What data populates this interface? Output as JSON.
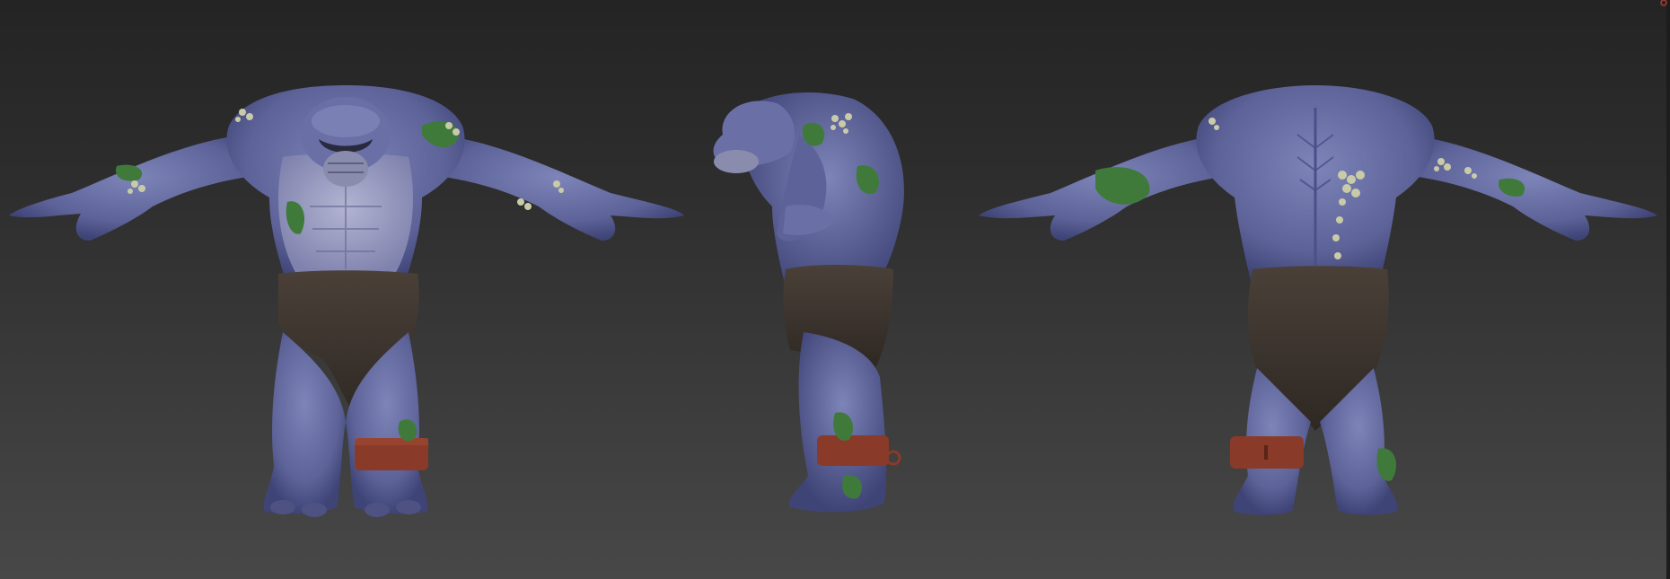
{
  "viewport": {
    "background_top": "#242424",
    "background_bottom": "#484848"
  },
  "model": {
    "skin_color": "#6b72a8",
    "skin_shadow": "#3f4477",
    "chest_color": "#9ea0c4",
    "loincloth_color": "#3e3630",
    "moss_color": "#3f7a3a",
    "barnacle_color": "#c9cba8",
    "shackle_color": "#8a3a28"
  },
  "views": [
    {
      "id": "front"
    },
    {
      "id": "side"
    },
    {
      "id": "back"
    }
  ],
  "icons": {
    "close": "close-icon"
  }
}
